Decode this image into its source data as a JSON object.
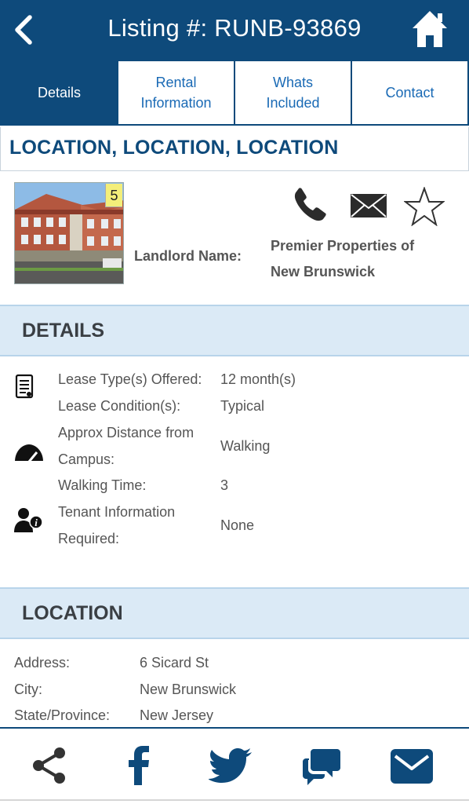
{
  "header": {
    "title": "Listing #: RUNB-93869",
    "back_icon": "chevron-left-icon",
    "home_icon": "home-icon"
  },
  "tabs": [
    {
      "label_1": "Details",
      "label_2": "",
      "active": true
    },
    {
      "label_1": "Rental",
      "label_2": "Information",
      "active": false
    },
    {
      "label_1": "Whats",
      "label_2": "Included",
      "active": false
    },
    {
      "label_1": "Contact",
      "label_2": "",
      "active": false
    }
  ],
  "location_banner": "LOCATION, LOCATION, LOCATION",
  "summary": {
    "photo_count": "5",
    "landlord_label": "Landlord Name:",
    "landlord_name_1": "Premier Properties of",
    "landlord_name_2": "New Brunswick",
    "actions": [
      "phone-icon",
      "envelope-icon",
      "star-icon"
    ]
  },
  "details": {
    "heading": "DETAILS",
    "rows": [
      {
        "label": "Lease Type(s) Offered:",
        "value": "12 month(s)"
      },
      {
        "label": "Lease Condition(s):",
        "value": "Typical"
      },
      {
        "label_1": "Approx Distance from",
        "label_2": "Campus:",
        "value": "Walking"
      },
      {
        "label": "Walking Time:",
        "value": "3"
      },
      {
        "label_1": "Tenant Information",
        "label_2": "Required:",
        "value": "None"
      }
    ]
  },
  "location": {
    "heading": "LOCATION",
    "rows": [
      {
        "label": "Address:",
        "value": "6 Sicard St"
      },
      {
        "label": "City:",
        "value": "New Brunswick"
      },
      {
        "label": "State/Province:",
        "value": "New Jersey"
      }
    ]
  },
  "footer": {
    "buttons": [
      "share-icon",
      "facebook-icon",
      "twitter-icon",
      "chat-icon",
      "mail-icon"
    ]
  },
  "colors": {
    "brand": "#0e4a7b",
    "link": "#1a6ab5",
    "section_bg": "#dbeaf6"
  }
}
